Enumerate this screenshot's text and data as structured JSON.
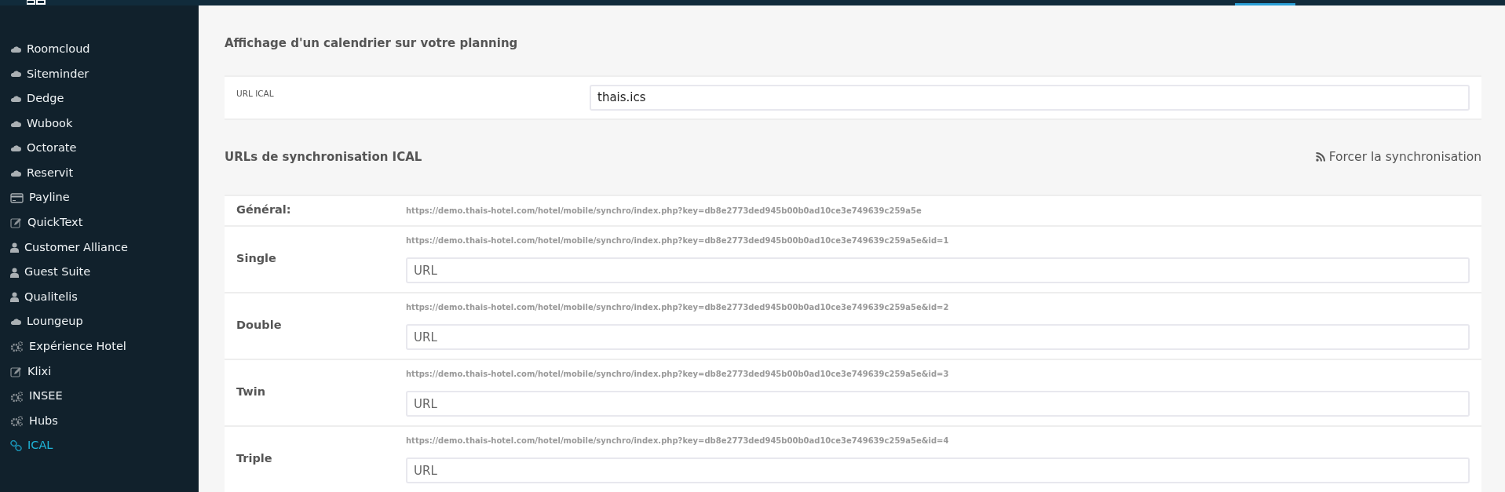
{
  "sidebar": {
    "items": [
      {
        "label": "Roomcloud",
        "kind": "cloud",
        "selected": false
      },
      {
        "label": "Siteminder",
        "kind": "cloud",
        "selected": false
      },
      {
        "label": "Dedge",
        "kind": "cloud",
        "selected": false
      },
      {
        "label": "Wubook",
        "kind": "cloud",
        "selected": false
      },
      {
        "label": "Octorate",
        "kind": "cloud",
        "selected": false
      },
      {
        "label": "Reservit",
        "kind": "cloud",
        "selected": false
      },
      {
        "label": "Payline",
        "kind": "card",
        "selected": false
      },
      {
        "label": "QuickText",
        "kind": "edit",
        "selected": false
      },
      {
        "label": "Customer Alliance",
        "kind": "user",
        "selected": false
      },
      {
        "label": "Guest Suite",
        "kind": "user",
        "selected": false
      },
      {
        "label": "Qualitelis",
        "kind": "user",
        "selected": false
      },
      {
        "label": "Loungeup",
        "kind": "cloud",
        "selected": false
      },
      {
        "label": "Expérience Hotel",
        "kind": "gears",
        "selected": false
      },
      {
        "label": "Klixi",
        "kind": "edit",
        "selected": false
      },
      {
        "label": "INSEE",
        "kind": "gears",
        "selected": false
      },
      {
        "label": "Hubs",
        "kind": "gears",
        "selected": false
      },
      {
        "label": "ICAL",
        "kind": "link",
        "selected": true
      }
    ]
  },
  "display_section": {
    "title": "Affichage d'un calendrier sur votre planning",
    "field_label": "URL ICAL",
    "field_value": "thais.ics"
  },
  "sync_section": {
    "title": "URLs de synchronisation ICAL",
    "action": "Forcer la synchronisation",
    "rows": [
      {
        "label": "Général:",
        "url": "https://demo.thais-hotel.com/hotel/mobile/synchro/index.php?key=db8e2773ded945b00b0ad10ce3e749639c259a5e"
      },
      {
        "label": "Single",
        "url": "https://demo.thais-hotel.com/hotel/mobile/synchro/index.php?key=db8e2773ded945b00b0ad10ce3e749639c259a5e&id=1",
        "placeholder": "URL"
      },
      {
        "label": "Double",
        "url": "https://demo.thais-hotel.com/hotel/mobile/synchro/index.php?key=db8e2773ded945b00b0ad10ce3e749639c259a5e&id=2",
        "placeholder": "URL"
      },
      {
        "label": "Twin",
        "url": "https://demo.thais-hotel.com/hotel/mobile/synchro/index.php?key=db8e2773ded945b00b0ad10ce3e749639c259a5e&id=3",
        "placeholder": "URL"
      },
      {
        "label": "Triple",
        "url": "https://demo.thais-hotel.com/hotel/mobile/synchro/index.php?key=db8e2773ded945b00b0ad10ce3e749639c259a5e&id=4",
        "placeholder": "URL"
      }
    ]
  }
}
